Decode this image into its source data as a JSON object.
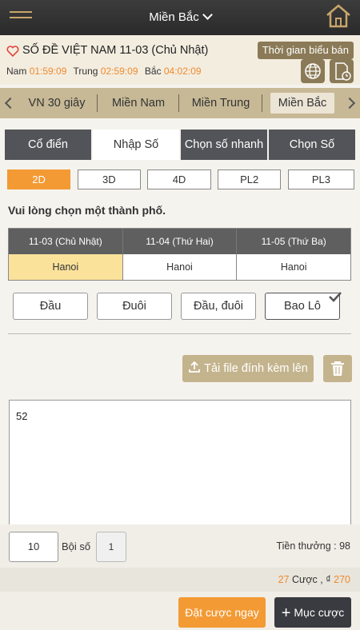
{
  "header": {
    "region": "Miền Bắc"
  },
  "game": {
    "title": "SỐ ĐỀ VIỆT NAM 11-03 (Chủ Nhật)",
    "schedule_label": "Thời gian biểu bán",
    "times": [
      {
        "label": "Nam",
        "value": "01:59:09"
      },
      {
        "label": "Trung",
        "value": "02:59:09"
      },
      {
        "label": "Bắc",
        "value": "04:02:09"
      }
    ]
  },
  "region_tabs": [
    "VN 30 giây",
    "Miền Nam",
    "Miền Trung",
    "Miền Bắc"
  ],
  "mode_tabs": [
    "Cổ điển",
    "Nhập Số",
    "Chọn số nhanh",
    "Chọn Số"
  ],
  "digit_tabs": [
    "2D",
    "3D",
    "4D",
    "PL2",
    "PL3"
  ],
  "choose_city_text": "Vui lòng chọn một thành phố.",
  "dates": [
    {
      "date": "11-03 (Chủ Nhật)",
      "city": "Hanoi"
    },
    {
      "date": "11-04 (Thứ Hai)",
      "city": "Hanoi"
    },
    {
      "date": "11-05 (Thứ Ba)",
      "city": "Hanoi"
    }
  ],
  "bet_types": [
    "Đầu",
    "Đuôi",
    "Đầu, đuôi",
    "Bao Lô"
  ],
  "upload_label": "Tải file đính kèm lên",
  "numbers_text": "52",
  "bet": {
    "amount": "10",
    "multiplier_label": "Bội số",
    "multiplier": "1",
    "reward": "Tiền thưởng : 98"
  },
  "summary": {
    "count": "27",
    "count_label": "Cược ,",
    "currency": "₫",
    "total": "270"
  },
  "footer": {
    "bet_now": "Đặt cược ngay",
    "bet_list": "Mục cược"
  }
}
